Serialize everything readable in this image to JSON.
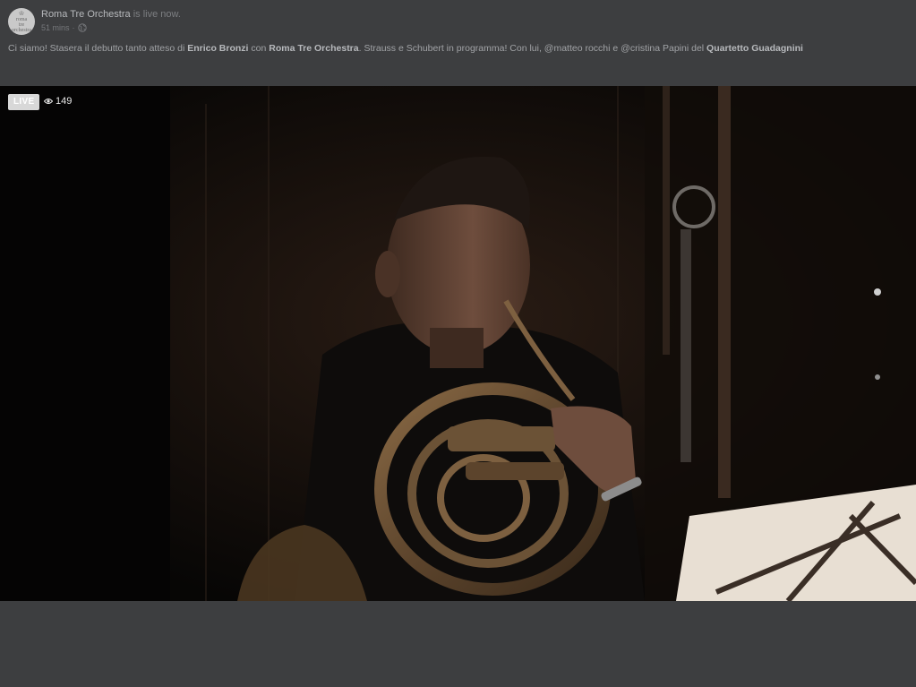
{
  "post": {
    "page_name": "Roma Tre Orchestra",
    "status": "is live now.",
    "time": "51 mins",
    "separator": "·",
    "avatar_text": [
      "roma",
      "tre",
      "orchestra"
    ],
    "caption": {
      "t1": "Ci siamo! Stasera il debutto tanto atteso di ",
      "b1": "Enrico Bronzi",
      "t2": " con ",
      "b2": "Roma Tre Orchestra",
      "t3": ". Strauss e Schubert in programma! Con lui, @matteo rocchi e @cristina Papini del ",
      "b3": "Quartetto Guadagnini"
    }
  },
  "video": {
    "live_label": "LIVE",
    "viewer_count": "149",
    "icons": {
      "viewers": "eye-icon",
      "privacy": "globe-icon"
    }
  },
  "colors": {
    "page_background": "#3d3e40",
    "video_background": "#0b0908",
    "live_badge": "#d8d8d8"
  }
}
